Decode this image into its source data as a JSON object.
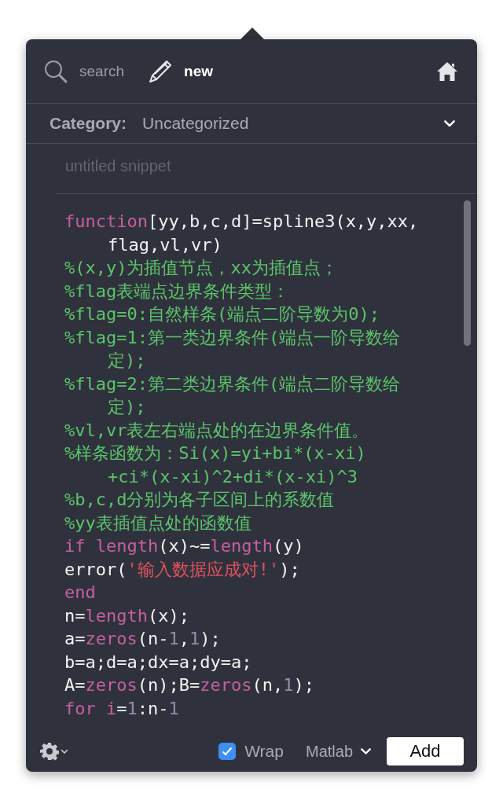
{
  "toolbar": {
    "tabs": [
      {
        "label": "search",
        "selected": false
      },
      {
        "label": "new",
        "selected": true
      }
    ]
  },
  "category": {
    "label": "Category:",
    "value": "Uncategorized"
  },
  "title_field": {
    "placeholder": "untitled snippet"
  },
  "code": [
    {
      "continued": false,
      "tokens": [
        {
          "kind": "keyword",
          "t": "function"
        },
        {
          "kind": "plain",
          "t": "[yy,b,c,d]=spline3(x,y,xx,"
        }
      ]
    },
    {
      "continued": true,
      "tokens": [
        {
          "kind": "plain",
          "t": "flag,vl,vr)"
        }
      ]
    },
    {
      "continued": false,
      "tokens": [
        {
          "kind": "comment",
          "t": "%(x,y)为插值节点，xx为插值点；"
        }
      ]
    },
    {
      "continued": false,
      "tokens": [
        {
          "kind": "comment",
          "t": "%flag表端点边界条件类型："
        }
      ]
    },
    {
      "continued": false,
      "tokens": [
        {
          "kind": "comment",
          "t": "%flag=0:自然样条(端点二阶导数为0);"
        }
      ]
    },
    {
      "continued": false,
      "tokens": [
        {
          "kind": "comment",
          "t": "%flag=1:第一类边界条件(端点一阶导数给"
        }
      ]
    },
    {
      "continued": true,
      "tokens": [
        {
          "kind": "comment",
          "t": "定);"
        }
      ]
    },
    {
      "continued": false,
      "tokens": [
        {
          "kind": "comment",
          "t": "%flag=2:第二类边界条件(端点二阶导数给"
        }
      ]
    },
    {
      "continued": true,
      "tokens": [
        {
          "kind": "comment",
          "t": "定);"
        }
      ]
    },
    {
      "continued": false,
      "tokens": [
        {
          "kind": "comment",
          "t": "%vl,vr表左右端点处的在边界条件值。"
        }
      ]
    },
    {
      "continued": false,
      "tokens": [
        {
          "kind": "comment",
          "t": "%样条函数为：Si(x)=yi+bi*(x-xi)"
        }
      ]
    },
    {
      "continued": true,
      "tokens": [
        {
          "kind": "comment",
          "t": "+ci*(x-xi)^2+di*(x-xi)^3"
        }
      ]
    },
    {
      "continued": false,
      "tokens": [
        {
          "kind": "comment",
          "t": "%b,c,d分别为各子区间上的系数值"
        }
      ]
    },
    {
      "continued": false,
      "tokens": [
        {
          "kind": "comment",
          "t": "%yy表插值点处的函数值"
        }
      ]
    },
    {
      "continued": false,
      "tokens": [
        {
          "kind": "keyword",
          "t": "if length"
        },
        {
          "kind": "plain",
          "t": "(x)~="
        },
        {
          "kind": "keyword",
          "t": "length"
        },
        {
          "kind": "plain",
          "t": "(y)"
        }
      ]
    },
    {
      "continued": false,
      "tokens": [
        {
          "kind": "plain",
          "t": "error("
        },
        {
          "kind": "string",
          "t": "'输入数据应成对!'"
        },
        {
          "kind": "plain",
          "t": ");"
        }
      ]
    },
    {
      "continued": false,
      "tokens": [
        {
          "kind": "keyword",
          "t": "end"
        }
      ]
    },
    {
      "continued": false,
      "tokens": [
        {
          "kind": "plain",
          "t": "n="
        },
        {
          "kind": "keyword",
          "t": "length"
        },
        {
          "kind": "plain",
          "t": "(x);"
        }
      ]
    },
    {
      "continued": false,
      "tokens": [
        {
          "kind": "plain",
          "t": "a="
        },
        {
          "kind": "keyword",
          "t": "zeros"
        },
        {
          "kind": "plain",
          "t": "(n-"
        },
        {
          "kind": "number",
          "t": "1"
        },
        {
          "kind": "plain",
          "t": ","
        },
        {
          "kind": "number",
          "t": "1"
        },
        {
          "kind": "plain",
          "t": ");"
        }
      ]
    },
    {
      "continued": false,
      "tokens": [
        {
          "kind": "plain",
          "t": "b=a;d=a;dx=a;dy=a;"
        }
      ]
    },
    {
      "continued": false,
      "tokens": [
        {
          "kind": "plain",
          "t": "A="
        },
        {
          "kind": "keyword",
          "t": "zeros"
        },
        {
          "kind": "plain",
          "t": "(n);B="
        },
        {
          "kind": "keyword",
          "t": "zeros"
        },
        {
          "kind": "plain",
          "t": "(n,"
        },
        {
          "kind": "number",
          "t": "1"
        },
        {
          "kind": "plain",
          "t": ");"
        }
      ]
    },
    {
      "continued": false,
      "tokens": [
        {
          "kind": "keyword",
          "t": "for i"
        },
        {
          "kind": "plain",
          "t": "="
        },
        {
          "kind": "number",
          "t": "1"
        },
        {
          "kind": "plain",
          "t": ":n-"
        },
        {
          "kind": "number",
          "t": "1"
        }
      ]
    }
  ],
  "footer": {
    "wrap": {
      "label": "Wrap",
      "checked": true
    },
    "language": "Matlab",
    "add_button": "Add"
  }
}
